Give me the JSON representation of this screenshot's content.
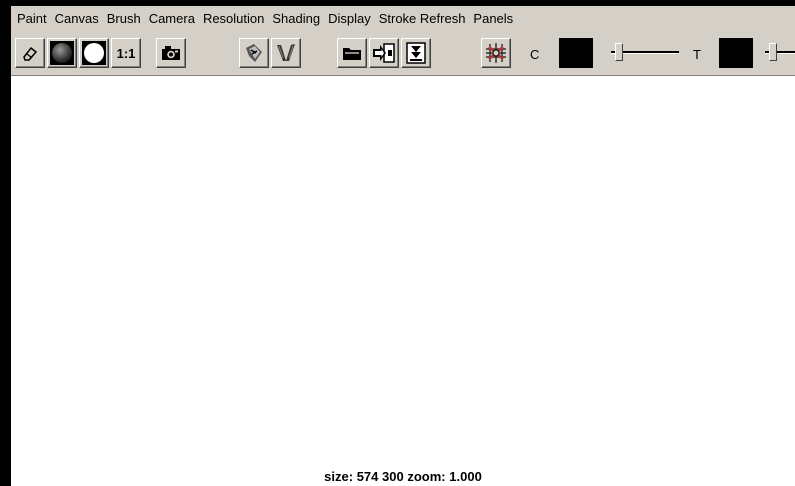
{
  "menubar": {
    "items": [
      {
        "label": "Paint"
      },
      {
        "label": "Canvas"
      },
      {
        "label": "Brush"
      },
      {
        "label": "Camera"
      },
      {
        "label": "Resolution"
      },
      {
        "label": "Shading"
      },
      {
        "label": "Display"
      },
      {
        "label": "Stroke Refresh"
      },
      {
        "label": "Panels"
      }
    ]
  },
  "toolbar": {
    "ratio_label": "1:1",
    "color_label": "C",
    "transparency_label": "T",
    "color_swatch": "#000000",
    "transparency_swatch": "#000000",
    "color_slider_value": 0,
    "transparency_slider_value": 0,
    "icons": {
      "eraser": "eraser-icon",
      "shaded_sphere": "shaded-sphere-icon",
      "white_sphere": "white-sphere-icon",
      "snapshot": "camera-icon",
      "brush_settings": "brush-settings-icon",
      "brush_pick": "brush-pick-icon",
      "open": "open-image-icon",
      "save": "save-image-icon",
      "import": "import-image-icon",
      "wrap": "wrap-icon"
    }
  },
  "status": {
    "size_label": "size:",
    "width": "574",
    "height": "300",
    "zoom_label": "zoom:",
    "zoom": "1.000"
  },
  "colors": {
    "chrome": "#d4d0c8",
    "canvas": "#ffffff",
    "border": "#000000"
  }
}
